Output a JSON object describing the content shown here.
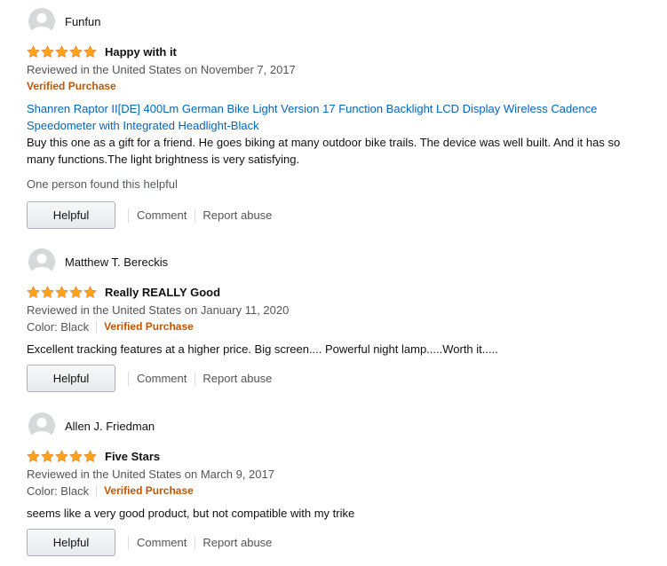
{
  "colors": {
    "star": "#ffa41c",
    "verified": "#c45500",
    "link": "#0066c0",
    "muted": "#555555"
  },
  "reviews": [
    {
      "profile_name": "Funfun",
      "rating": 5,
      "title": "Happy with it",
      "date": "Reviewed in the United States on November 7, 2017",
      "verified": "Verified Purchase",
      "product": "Shanren Raptor II[DE] 400Lm German Bike Light Version 17 Function Backlight LCD Display Wireless Cadence Speedometer with Integrated Headlight-Black",
      "body": "Buy this one as a gift for a friend. He goes biking at many outdoor bike trails. The device was well built. And it has so many functions.The light brightness is very satisfying.",
      "helpful_count": "One person found this helpful",
      "helpful_label": "Helpful",
      "comment_label": "Comment",
      "report_label": "Report abuse"
    },
    {
      "profile_name": "Matthew T. Bereckis",
      "rating": 5,
      "title": "Really REALLY Good",
      "date": "Reviewed in the United States on January 11, 2020",
      "color": "Color: Black",
      "verified": "Verified Purchase",
      "body": "Excellent tracking features at a higher price. Big screen.... Powerful night lamp.....Worth it.....",
      "helpful_label": "Helpful",
      "comment_label": "Comment",
      "report_label": "Report abuse"
    },
    {
      "profile_name": "Allen J. Friedman",
      "rating": 5,
      "title": "Five Stars",
      "date": "Reviewed in the United States on March 9, 2017",
      "color": "Color: Black",
      "verified": "Verified Purchase",
      "body": "seems like a very good product, but not compatible with my trike",
      "helpful_label": "Helpful",
      "comment_label": "Comment",
      "report_label": "Report abuse"
    }
  ]
}
